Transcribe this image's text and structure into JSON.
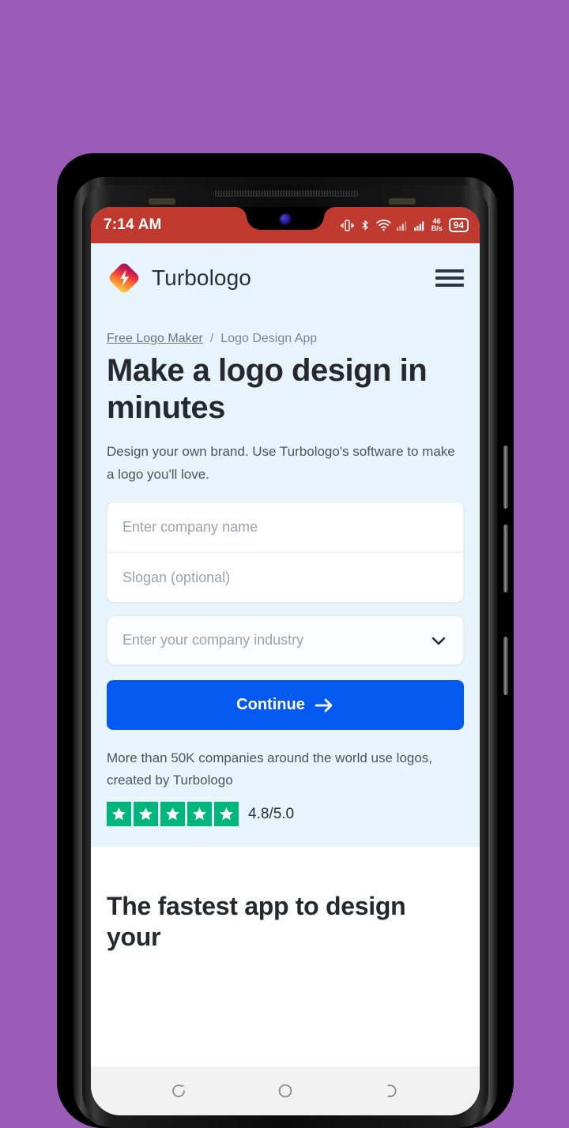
{
  "device": {
    "background_color": "#9b5cb8",
    "frame_color": "#000000"
  },
  "status_bar": {
    "time": "7:14 AM",
    "background_color": "#c0392f",
    "icons": [
      "vibrate-icon",
      "bluetooth-icon",
      "wifi-icon",
      "signal-icon-1",
      "signal-icon-2"
    ],
    "network_speed_value": "46",
    "network_speed_unit": "B/s",
    "battery_level": "94"
  },
  "site_header": {
    "logo_icon": "turbologo-diamond-icon",
    "brand_name": "Turbologo",
    "menu_icon": "hamburger-menu-icon"
  },
  "hero": {
    "breadcrumb": {
      "link_label": "Free Logo Maker",
      "separator": "/",
      "current_label": "Logo Design App"
    },
    "title": "Make a logo design in minutes",
    "subtitle": "Design your own brand. Use Turbologo's software to make a logo you'll love.",
    "background_color": "#e8f4fb",
    "form": {
      "company_name_placeholder": "Enter company name",
      "slogan_placeholder": "Slogan (optional)",
      "industry_placeholder": "Enter your company industry",
      "industry_chevron_icon": "chevron-down-icon",
      "submit_label": "Continue",
      "submit_arrow_icon": "arrow-right-icon",
      "submit_color": "#0459f0"
    },
    "social_proof": "More than 50K companies around the world use logos, created by Turbologo",
    "rating": {
      "stars": 5,
      "star_color": "#00b67a",
      "value": "4.8/5.0"
    }
  },
  "next_section": {
    "title": "The fastest app to design your"
  },
  "android_nav": {
    "back_label": "back-button",
    "home_label": "home-button",
    "recents_label": "recents-button"
  }
}
